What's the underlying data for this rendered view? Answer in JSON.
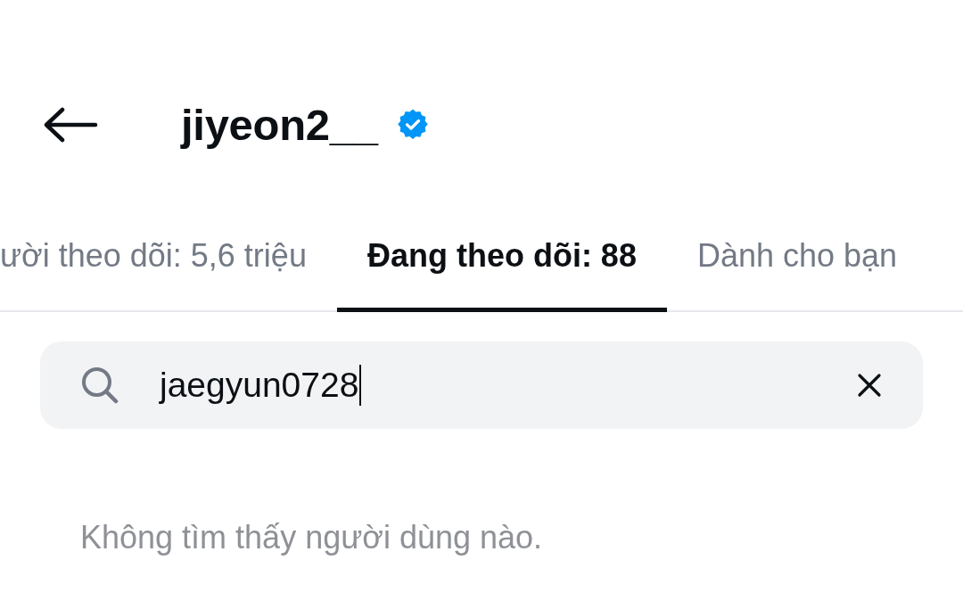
{
  "header": {
    "title": "jiyeon2__",
    "verified": true
  },
  "tabs": [
    {
      "label": "ười theo dõi: 5,6 triệu",
      "selected": false
    },
    {
      "label": "Đang theo dõi: 88",
      "selected": true
    },
    {
      "label": "Dành cho bạn",
      "selected": false
    }
  ],
  "search": {
    "value": "jaegyun0728",
    "focused": true
  },
  "empty_message": "Không tìm thấy người dùng nào."
}
